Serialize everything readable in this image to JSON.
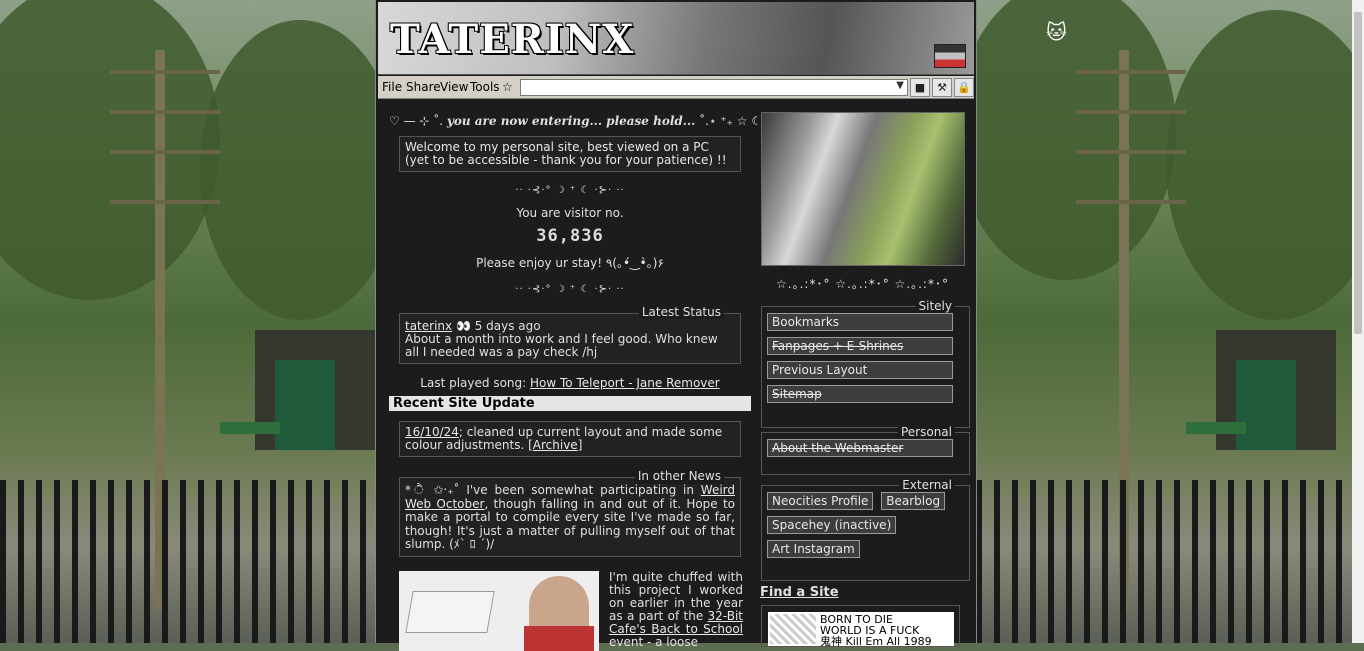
{
  "header": {
    "logo": "TATERINX"
  },
  "menu": {
    "file": "File",
    "share": "Share",
    "view": "View",
    "tools": "Tools",
    "star": "☆"
  },
  "toolbar": {
    "save_icon": "floppy-disk-icon",
    "settings_icon": "hammer-icon",
    "lock_icon": "lock-icon"
  },
  "intro": {
    "entering_pre": "♡ — ⊹ ˚.",
    "entering_bold": "you are now entering... please hold...",
    "entering_post": "˚.⋆ ⁺₊ ☆ ☾3 ⋆.˚",
    "welcome": "Welcome to my personal site, best viewed on a PC (yet to be accessible - thank you for your patience) !!",
    "divider": "·· ·⊰·° ☽ ⁺ ☾ ·⊱· ··",
    "visitor_label": "You are visitor no.",
    "counter": "36,836",
    "enjoy": "Please enjoy ur stay! ٩(｡•́‿•̀｡)۶"
  },
  "status": {
    "legend": "Latest Status",
    "user": "taterinx",
    "meta": "👀 5 days ago",
    "text": "About a month into work and I feel good. Who knew all I needed was a pay check /hj"
  },
  "last_played": {
    "label": "Last played song:",
    "song": "How To Teleport - Jane Remover"
  },
  "updates": {
    "title": "Recent Site Update",
    "date": "16/10/24",
    "text": "; cleaned up current layout and made some colour adjustments. [",
    "archive": "Archive",
    "close": "]"
  },
  "news": {
    "legend": "In other News",
    "pre": "* ੈ ✩‧₊˚ I've been somewhat participating in ",
    "link": "Weird Web October",
    "text": ", though falling in and out of it. Hope to make a portal to compile every site I've made so far, though! It's just a matter of pulling myself out of that slump. (ﾒ` ﾛ ´)/",
    "napoleon_pre": "I'm quite chuffed with this project I worked on earlier in the year as a part of the ",
    "napoleon_link": "32-Bit Cafe's Back to School",
    "napoleon_post": " event - a loose"
  },
  "sidebar": {
    "stars": "☆.｡.:*･°  ☆.｡.:*･°  ☆.｡.:*･°",
    "sitely": {
      "legend": "Sitely",
      "items": [
        "Bookmarks",
        "Fanpages + E-Shrines",
        "Previous Layout",
        "Sitemap"
      ]
    },
    "personal": {
      "legend": "Personal",
      "items": [
        "About the Webmaster"
      ]
    },
    "external": {
      "legend": "External",
      "items": [
        "Neocities Profile",
        "Bearblog",
        "Spacehey (inactive)",
        "Art Instagram"
      ]
    },
    "find": "Find a Site",
    "banner_line1": "BORN TO DIE",
    "banner_line2": "WORLD IS A FUCK",
    "banner_line3": "鬼神 Kill Em All 1989"
  }
}
